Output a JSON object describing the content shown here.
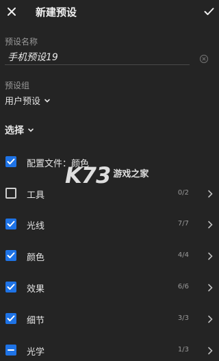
{
  "header": {
    "title": "新建预设"
  },
  "preset_name": {
    "label": "预设名称",
    "value": "手机预设19"
  },
  "preset_group": {
    "label": "预设组",
    "value": "用户预设"
  },
  "select_dropdown": {
    "label": "选择"
  },
  "items": [
    {
      "label": "配置文件：颜色",
      "count": "",
      "state": "checked"
    },
    {
      "label": "工具",
      "count": "0/2",
      "state": "unchecked"
    },
    {
      "label": "光线",
      "count": "7/7",
      "state": "checked"
    },
    {
      "label": "颜色",
      "count": "4/4",
      "state": "checked"
    },
    {
      "label": "效果",
      "count": "6/6",
      "state": "checked"
    },
    {
      "label": "细节",
      "count": "3/3",
      "state": "checked"
    },
    {
      "label": "光学",
      "count": "1/3",
      "state": "partial"
    }
  ],
  "watermark": {
    "logo": "K73",
    "text": "游戏之家"
  },
  "colors": {
    "background": "#242424",
    "accent": "#1e73e6",
    "text": "#e6e6e6",
    "muted": "#9a9a9a"
  }
}
